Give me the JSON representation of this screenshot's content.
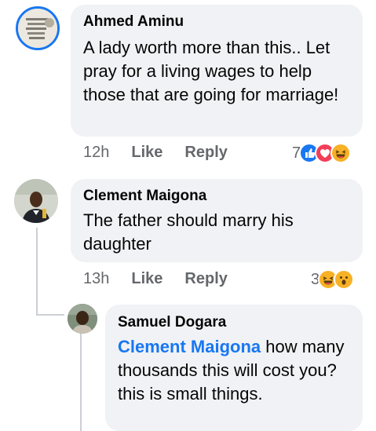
{
  "comments": [
    {
      "author": "Ahmed Aminu",
      "text": "A lady worth more than this.. Let pray for a living wages to help those that are going for marriage!",
      "time": "12h",
      "like_label": "Like",
      "reply_label": "Reply",
      "reaction_count": "7",
      "reactions": [
        "like-icon",
        "love-icon",
        "haha-icon"
      ]
    },
    {
      "author": "Clement Maigona",
      "text": "The father should marry his daughter",
      "time": "13h",
      "like_label": "Like",
      "reply_label": "Reply",
      "reaction_count": "3",
      "reactions": [
        "haha-icon",
        "wow-icon"
      ]
    }
  ],
  "reply": {
    "author": "Samuel Dogara",
    "mention": "Clement Maigona",
    "text": " how many thousands this will cost you? this is small things."
  },
  "colors": {
    "bubble": "#f0f2f5",
    "meta": "#65676b",
    "mention": "#1877f2",
    "like": "#1877f2",
    "love": "#f33e58",
    "haha": "#f7b125"
  }
}
